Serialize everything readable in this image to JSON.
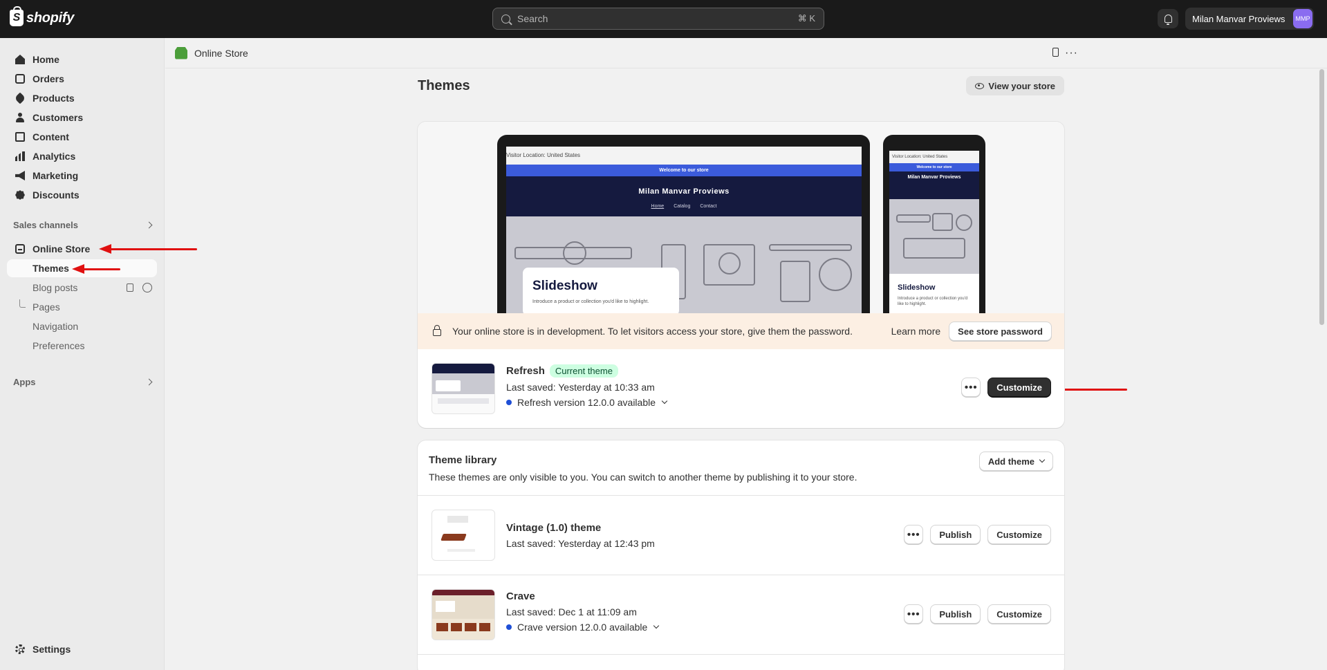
{
  "topbar": {
    "logo_text": "shopify",
    "logo_glyph": "S",
    "search_placeholder": "Search",
    "search_shortcut": "⌘ K",
    "user_name": "Milan Manvar Proviews",
    "avatar_initials": "MMP"
  },
  "sidebar": {
    "items": [
      {
        "label": "Home",
        "icon": "home-icon"
      },
      {
        "label": "Orders",
        "icon": "orders-icon"
      },
      {
        "label": "Products",
        "icon": "tag-icon"
      },
      {
        "label": "Customers",
        "icon": "person-icon"
      },
      {
        "label": "Content",
        "icon": "content-icon"
      },
      {
        "label": "Analytics",
        "icon": "bar-chart-icon"
      },
      {
        "label": "Marketing",
        "icon": "megaphone-icon"
      },
      {
        "label": "Discounts",
        "icon": "discount-icon"
      }
    ],
    "sales_channels_label": "Sales channels",
    "online_store_label": "Online Store",
    "sub_items": [
      "Themes",
      "Blog posts",
      "Pages",
      "Navigation",
      "Preferences"
    ],
    "apps_label": "Apps",
    "settings_label": "Settings"
  },
  "page_header": {
    "title": "Online Store"
  },
  "main": {
    "title": "Themes",
    "view_store_label": "View your store",
    "preview": {
      "location": "Visitor Location: United States",
      "announcement": "Welcome to our store",
      "brand": "Milan Manvar Proviews",
      "nav": [
        "Home",
        "Catalog",
        "Contact"
      ],
      "slideshow_title": "Slideshow",
      "slideshow_sub": "Introduce a product or collection you'd like to highlight."
    },
    "banner": {
      "message": "Your online store is in development. To let visitors access your store, give them the password.",
      "learn_more": "Learn more",
      "button": "See store password"
    },
    "current_theme": {
      "name": "Refresh",
      "badge": "Current theme",
      "last_saved": "Last saved: Yesterday at 10:33 am",
      "version": "Refresh version 12.0.0 available",
      "customize": "Customize",
      "more": "•••"
    },
    "library": {
      "title": "Theme library",
      "subtitle": "These themes are only visible to you. You can switch to another theme by publishing it to your store.",
      "add_theme": "Add theme",
      "themes": [
        {
          "name": "Vintage (1.0) theme",
          "last_saved": "Last saved: Yesterday at 12:43 pm",
          "version": "",
          "publish": "Publish",
          "customize": "Customize",
          "more": "•••"
        },
        {
          "name": "Crave",
          "last_saved": "Last saved: Dec 1 at 11:09 am",
          "version": "Crave version 12.0.0 available",
          "publish": "Publish",
          "customize": "Customize",
          "more": "•••"
        }
      ]
    }
  },
  "colors": {
    "topbar": "#1a1a1a",
    "accent_arrow": "#e01010",
    "badge_bg": "#cdfee1",
    "banner_bg": "#fcefe3",
    "version_dot": "#1f4fd6"
  }
}
